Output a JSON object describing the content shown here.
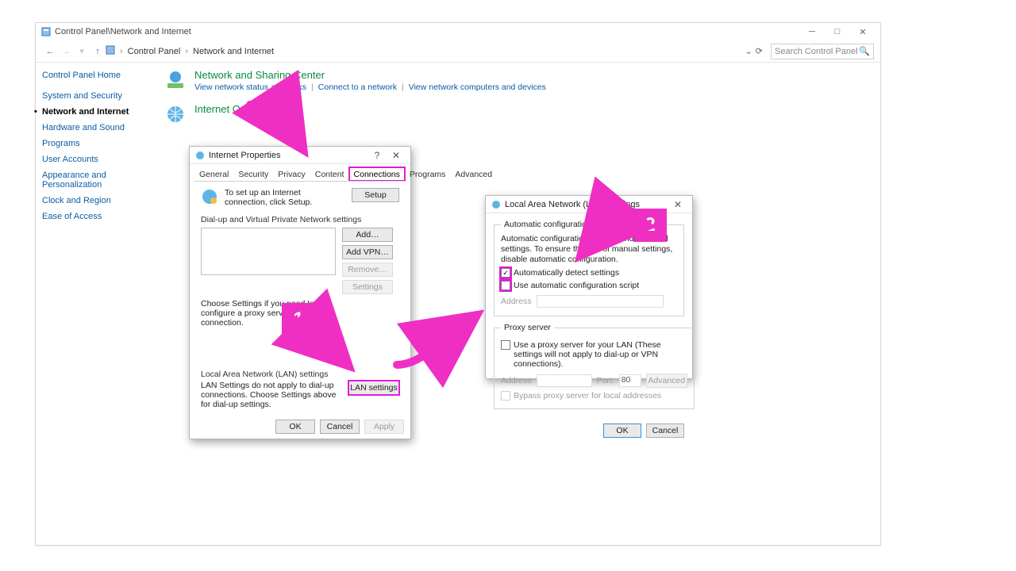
{
  "window": {
    "title": "Control Panel\\Network and Internet",
    "breadcrumbs": [
      "Control Panel",
      "Network and Internet"
    ],
    "search_placeholder": "Search Control Panel"
  },
  "sidebar": {
    "home": "Control Panel Home",
    "items": [
      {
        "label": "System and Security",
        "current": false
      },
      {
        "label": "Network and Internet",
        "current": true
      },
      {
        "label": "Hardware and Sound",
        "current": false
      },
      {
        "label": "Programs",
        "current": false
      },
      {
        "label": "User Accounts",
        "current": false
      },
      {
        "label": "Appearance and Personalization",
        "current": false
      },
      {
        "label": "Clock and Region",
        "current": false
      },
      {
        "label": "Ease of Access",
        "current": false
      }
    ]
  },
  "main": {
    "nsc": {
      "title": "Network and Sharing Center",
      "links": [
        "View network status and tasks",
        "Connect to a network",
        "View network computers and devices"
      ]
    },
    "io": {
      "title": "Internet Options"
    }
  },
  "ip_dialog": {
    "title": "Internet Properties",
    "tabs": [
      "General",
      "Security",
      "Privacy",
      "Content",
      "Connections",
      "Programs",
      "Advanced"
    ],
    "active_tab": "Connections",
    "setup_text": "To set up an Internet connection, click Setup.",
    "setup_btn": "Setup",
    "dialup_label": "Dial-up and Virtual Private Network settings",
    "btn_add": "Add…",
    "btn_addvpn": "Add VPN…",
    "btn_remove": "Remove…",
    "btn_settings": "Settings",
    "choose_text": "Choose Settings if you need to configure a proxy server for a connection.",
    "lan_label": "Local Area Network (LAN) settings",
    "lan_text": "LAN Settings do not apply to dial-up connections. Choose Settings above for dial-up settings.",
    "lan_btn": "LAN settings",
    "ok": "OK",
    "cancel": "Cancel",
    "apply": "Apply"
  },
  "lan_dialog": {
    "title": "Local Area Network (LAN) Settings",
    "auto_legend": "Automatic configuration",
    "auto_text": "Automatic configuration may override manual settings. To ensure the use of manual settings, disable automatic configuration.",
    "auto_detect": "Automatically detect settings",
    "auto_script": "Use automatic configuration script",
    "address_label": "Address",
    "proxy_legend": "Proxy server",
    "proxy_text": "Use a proxy server for your LAN (These settings will not apply to dial-up or VPN connections).",
    "port_label": "Port:",
    "port_value": "80",
    "advanced": "Advanced",
    "bypass": "Bypass proxy server for local addresses",
    "ok": "OK",
    "cancel": "Cancel"
  },
  "badges": {
    "one": "1",
    "two": "2"
  }
}
